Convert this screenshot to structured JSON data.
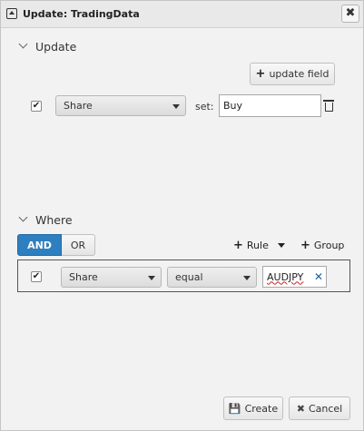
{
  "window": {
    "title": "Update: TradingData",
    "close_label": "✖"
  },
  "update": {
    "section_label": "Update",
    "add_field_label": "update field",
    "row": {
      "checked": true,
      "field": "Share",
      "set_label": "set:",
      "value": "Buy"
    }
  },
  "where": {
    "section_label": "Where",
    "and_label": "AND",
    "or_label": "OR",
    "rule_label": "Rule",
    "group_label": "Group",
    "rule": {
      "checked": true,
      "field": "Share",
      "operator": "equal",
      "value": "AUDJPY"
    }
  },
  "footer": {
    "create_label": "Create",
    "cancel_label": "Cancel"
  },
  "colors": {
    "accent": "#2e7fbf",
    "dialog_bg": "#f2f2f2"
  }
}
